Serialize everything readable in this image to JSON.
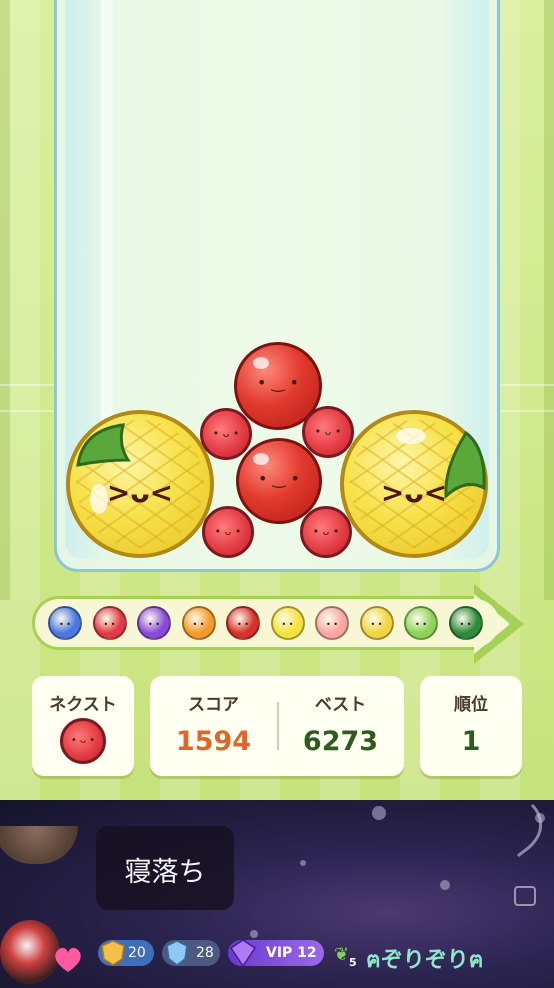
{
  "next_card": {
    "label": "ネクスト",
    "fruit_icon": "strawberry-icon"
  },
  "score_card": {
    "score_label": "スコア",
    "score_value": "1594",
    "best_label": "ベスト",
    "best_value": "6273"
  },
  "rank_card": {
    "label": "順位",
    "value": "1"
  },
  "evolution": {
    "items": [
      {
        "name": "blueberry-icon",
        "color": "#4a78e0"
      },
      {
        "name": "strawberry-icon",
        "color": "#e03a44"
      },
      {
        "name": "grape-icon",
        "color": "#8a4ad8"
      },
      {
        "name": "orange-icon",
        "color": "#f49a2a"
      },
      {
        "name": "apple-icon",
        "color": "#d8302a"
      },
      {
        "name": "lemon-icon",
        "color": "#f6e23a"
      },
      {
        "name": "peach-icon",
        "color": "#f8a6a0"
      },
      {
        "name": "pineapple-icon",
        "color": "#f2d440"
      },
      {
        "name": "green-melon-icon",
        "color": "#8ed25a"
      },
      {
        "name": "watermelon-icon",
        "color": "#2f8a3a"
      }
    ]
  },
  "chat": {
    "message": "寝落ち"
  },
  "viewer": {
    "badge_1": "20",
    "badge_2": "28",
    "vip_label": "VIP 12",
    "sprout_level": "5",
    "name": "ฅぞりぞりฅ"
  },
  "colors": {
    "score": "#e0652a",
    "best": "#2f5a20",
    "rank": "#2f5a20",
    "accent_green": "#a5d256"
  }
}
